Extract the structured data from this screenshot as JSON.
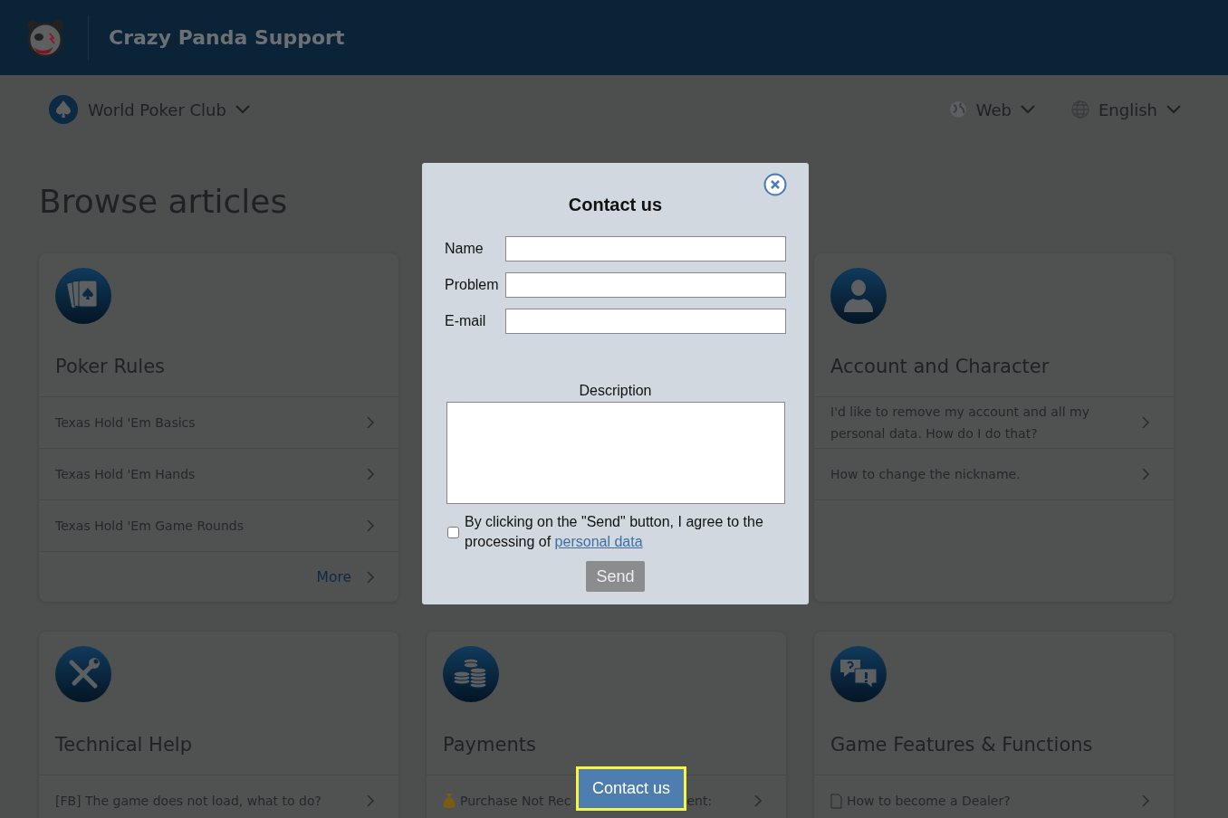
{
  "header": {
    "title": "Crazy Panda Support"
  },
  "toolbar": {
    "game": "World Poker Club",
    "platform": "Web",
    "language": "English"
  },
  "heading": "Browse articles",
  "cards": [
    {
      "title": "Poker Rules",
      "articles": [
        {
          "kind": "plain",
          "title": "Texas Hold 'Em Basics"
        },
        {
          "kind": "plain",
          "title": "Texas Hold 'Em Hands"
        },
        {
          "kind": "plain",
          "title": "Texas Hold 'Em Game Rounds"
        }
      ],
      "more": "More"
    },
    {
      "title": "Account and Character",
      "articles": [
        {
          "kind": "plain",
          "title": "I'd like to remove my account and all my personal data. How do I do that?"
        },
        {
          "kind": "plain",
          "title": "How to change the nickname."
        }
      ]
    },
    {
      "title": "Technical Help",
      "articles": [
        {
          "kind": "plain",
          "title": "[FB] The game does not load, what to do?"
        }
      ]
    },
    {
      "title": "Payments",
      "articles": [
        {
          "kind": "bag",
          "title_start": "Purchase Not Rec",
          "title_end": "ent:"
        }
      ]
    },
    {
      "title": "Game Features & Functions",
      "articles": [
        {
          "kind": "document",
          "title": "How to become a Dealer?"
        }
      ]
    }
  ],
  "dialog": {
    "title": "Contact us",
    "fields": [
      {
        "label": "Name"
      },
      {
        "label": "Problem"
      },
      {
        "label": "E-mail"
      }
    ],
    "description_label": "Description",
    "consent": {
      "checked": false,
      "text": "By clicking on the \"Send\" button, I agree to the processing of",
      "link": "personal data"
    },
    "send": "Send"
  },
  "contact_button": "Contact us"
}
